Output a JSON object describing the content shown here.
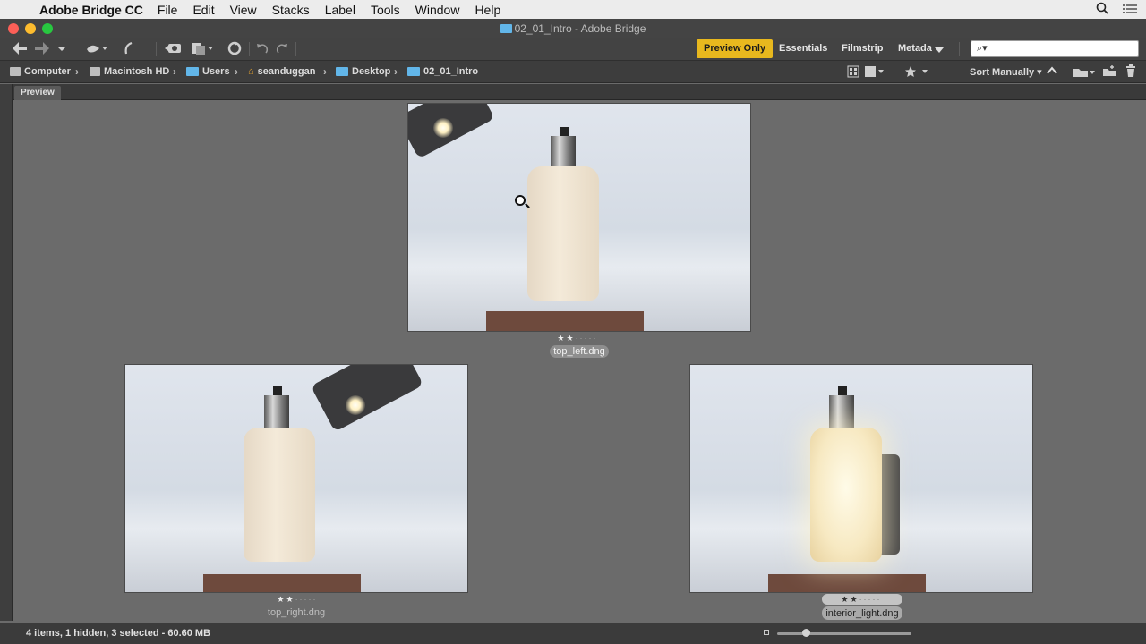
{
  "menubar": {
    "app_name": "Adobe Bridge CC",
    "items": [
      "File",
      "Edit",
      "View",
      "Stacks",
      "Label",
      "Tools",
      "Window",
      "Help"
    ]
  },
  "window": {
    "title": "02_01_Intro - Adobe Bridge"
  },
  "toolbar": {
    "workspaces": [
      "Preview Only",
      "Essentials",
      "Filmstrip",
      "Metadata"
    ],
    "active_workspace": "Preview Only",
    "active_color": "#e8b81e",
    "search_placeholder": "⌕▾"
  },
  "path": {
    "crumbs": [
      "Computer",
      "Macintosh HD",
      "Users",
      "seanduggan",
      "Desktop",
      "02_01_Intro"
    ],
    "sort_label": "Sort Manually"
  },
  "panel": {
    "tab": "Preview"
  },
  "previews": [
    {
      "filename": "top_left.dng",
      "rating": 2,
      "max_rating": 5,
      "selected": false
    },
    {
      "filename": "top_right.dng",
      "rating": 2,
      "max_rating": 5,
      "selected": false
    },
    {
      "filename": "interior_light.dng",
      "rating": 2,
      "max_rating": 5,
      "selected": true
    }
  ],
  "status": {
    "text": "4 items, 1 hidden, 3 selected - 60.60 MB",
    "thumbnail_size": 0.2
  }
}
